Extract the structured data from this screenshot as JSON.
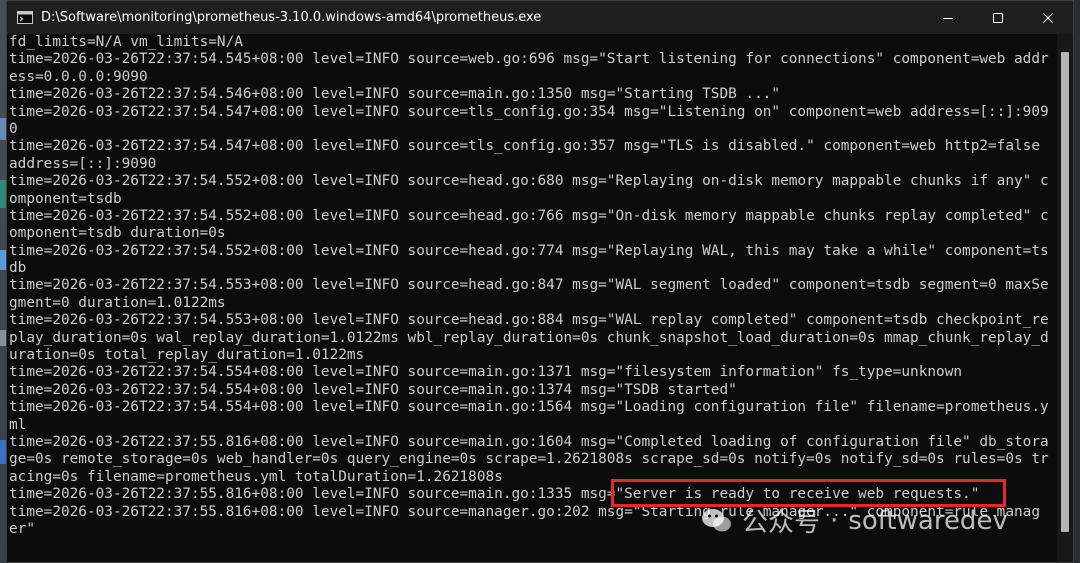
{
  "window": {
    "title": "D:\\Software\\monitoring\\prometheus-3.10.0.windows-amd64\\prometheus.exe"
  },
  "console": {
    "lines": [
      "fd_limits=N/A vm_limits=N/A",
      "time=2026-03-26T22:37:54.545+08:00 level=INFO source=web.go:696 msg=\"Start listening for connections\" component=web addr",
      "ess=0.0.0.0:9090",
      "time=2026-03-26T22:37:54.546+08:00 level=INFO source=main.go:1350 msg=\"Starting TSDB ...\"",
      "time=2026-03-26T22:37:54.547+08:00 level=INFO source=tls_config.go:354 msg=\"Listening on\" component=web address=[::]:909",
      "0",
      "time=2026-03-26T22:37:54.547+08:00 level=INFO source=tls_config.go:357 msg=\"TLS is disabled.\" component=web http2=false",
      "address=[::]:9090",
      "time=2026-03-26T22:37:54.552+08:00 level=INFO source=head.go:680 msg=\"Replaying on-disk memory mappable chunks if any\" c",
      "omponent=tsdb",
      "time=2026-03-26T22:37:54.552+08:00 level=INFO source=head.go:766 msg=\"On-disk memory mappable chunks replay completed\" c",
      "omponent=tsdb duration=0s",
      "time=2026-03-26T22:37:54.552+08:00 level=INFO source=head.go:774 msg=\"Replaying WAL, this may take a while\" component=ts",
      "db",
      "time=2026-03-26T22:37:54.553+08:00 level=INFO source=head.go:847 msg=\"WAL segment loaded\" component=tsdb segment=0 maxSe",
      "gment=0 duration=1.0122ms",
      "time=2026-03-26T22:37:54.553+08:00 level=INFO source=head.go:884 msg=\"WAL replay completed\" component=tsdb checkpoint_re",
      "play_duration=0s wal_replay_duration=1.0122ms wbl_replay_duration=0s chunk_snapshot_load_duration=0s mmap_chunk_replay_d",
      "uration=0s total_replay_duration=1.0122ms",
      "time=2026-03-26T22:37:54.554+08:00 level=INFO source=main.go:1371 msg=\"filesystem information\" fs_type=unknown",
      "time=2026-03-26T22:37:54.554+08:00 level=INFO source=main.go:1374 msg=\"TSDB started\"",
      "time=2026-03-26T22:37:54.554+08:00 level=INFO source=main.go:1564 msg=\"Loading configuration file\" filename=prometheus.y",
      "ml",
      "time=2026-03-26T22:37:55.816+08:00 level=INFO source=main.go:1604 msg=\"Completed loading of configuration file\" db_stora",
      "ge=0s remote_storage=0s web_handler=0s query_engine=0s scrape=1.2621808s scrape_sd=0s notify=0s notify_sd=0s rules=0s tr",
      "acing=0s filename=prometheus.yml totalDuration=1.2621808s",
      "time=2026-03-26T22:37:55.816+08:00 level=INFO source=main.go:1335 msg=\"Server is ready to receive web requests.\"",
      "time=2026-03-26T22:37:55.816+08:00 level=INFO source=manager.go:202 msg=\"Starting rule manager...\" component=rule manag",
      "er\""
    ]
  },
  "watermark": {
    "account": "公众号",
    "separator": "·",
    "name": "softwaredev"
  },
  "colors": {
    "console_bg": "#0c0c0c",
    "console_text": "#cccccc",
    "titlebar_bg": "#1f1f1f",
    "highlight": "#e8262d"
  },
  "icons": {
    "app": "terminal-icon",
    "minimize": "minimize-icon",
    "maximize": "maximize-icon",
    "close": "close-icon",
    "watermark": "wechat-icon"
  }
}
